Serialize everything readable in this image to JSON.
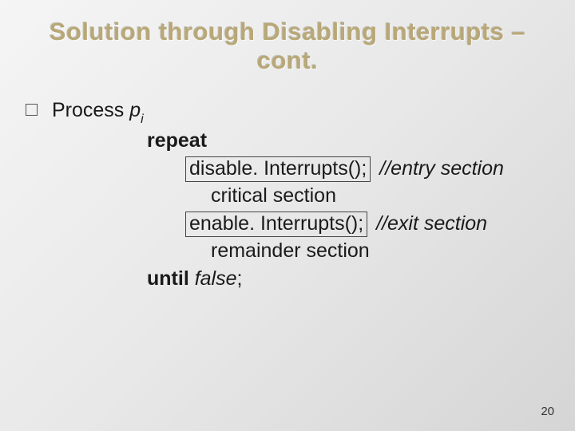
{
  "title": {
    "line1": "Solution through Disabling Interrupts –",
    "line2": "cont."
  },
  "process": {
    "label_prefix": "Process ",
    "var": "p",
    "sub": "i"
  },
  "code": {
    "repeat": "repeat",
    "disable_call": "disable. Interrupts();",
    "entry_comment": "//entry section",
    "critical": "critical section",
    "enable_call": "enable. Interrupts();",
    "exit_comment": "//exit section",
    "remainder": "remainder section",
    "until_kw": "until",
    "until_cond": " false",
    "semicolon": ";"
  },
  "slide_number": "20"
}
